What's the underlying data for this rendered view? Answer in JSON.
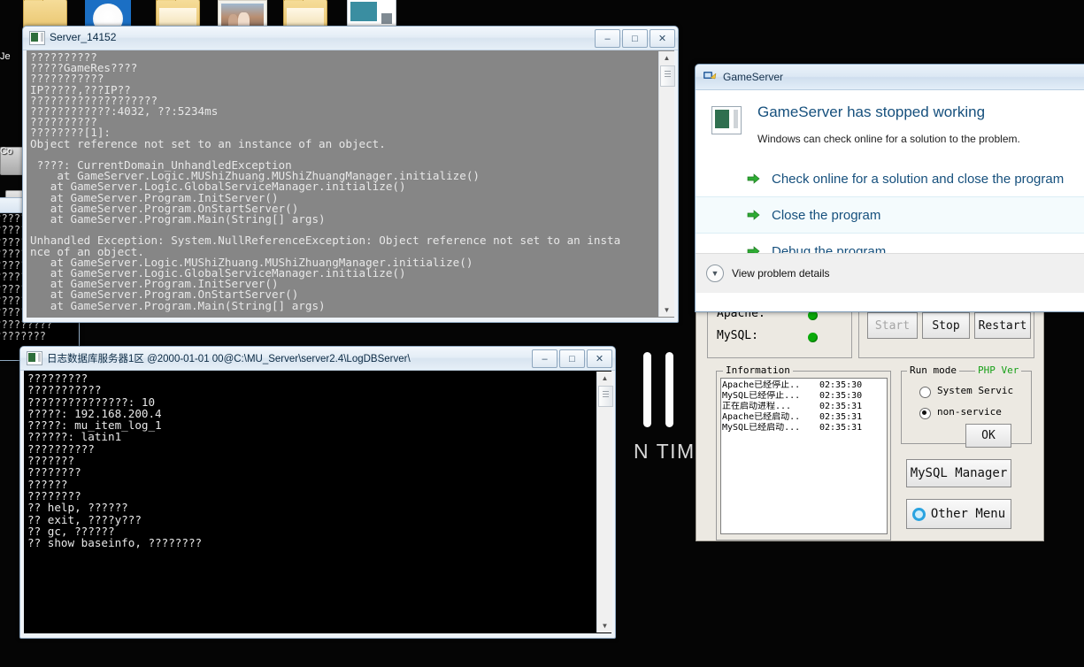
{
  "desktop": {
    "icons": [
      {
        "type": "folder-icon",
        "label": "Je"
      },
      {
        "type": "disc-icon",
        "label": ""
      },
      {
        "type": "folder-icon",
        "label": ""
      },
      {
        "type": "photo-icon",
        "label": ""
      },
      {
        "type": "folder-icon",
        "label": ""
      },
      {
        "type": "window-icon",
        "label": ""
      }
    ],
    "side_labels": [
      "Je",
      "Co"
    ],
    "wallpaper_text": "N TIME"
  },
  "server_window": {
    "title": "Server_14152",
    "buttons": {
      "minimize": "–",
      "maximize": "□",
      "close": "✕"
    },
    "console_lines": [
      "??????????",
      "?????GameRes????",
      "???????????",
      "IP?????,???IP??",
      "???????????????????",
      "????????????:4032, ??:5234ms",
      "??????????",
      "????????[1]:",
      "Object reference not set to an instance of an object.",
      "",
      " ????: CurrentDomain_UnhandledException",
      "    at GameServer.Logic.MUShiZhuang.MUShiZhuangManager.initialize()",
      "   at GameServer.Logic.GlobalServiceManager.initialize()",
      "   at GameServer.Program.InitServer()",
      "   at GameServer.Program.OnStartServer()",
      "   at GameServer.Program.Main(String[] args)",
      "",
      "Unhandled Exception: System.NullReferenceException: Object reference not set to an insta",
      "nce of an object.",
      "   at GameServer.Logic.MUShiZhuang.MUShiZhuangManager.initialize()",
      "   at GameServer.Logic.GlobalServiceManager.initialize()",
      "   at GameServer.Program.InitServer()",
      "   at GameServer.Program.OnStartServer()",
      "   at GameServer.Program.Main(String[] args)"
    ]
  },
  "logdb_window": {
    "title": "日志数据库服务器1区 @2000-01-01 00@C:\\MU_Server\\server2.4\\LogDBServer\\",
    "buttons": {
      "minimize": "–",
      "maximize": "□",
      "close": "✕"
    },
    "console_lines": [
      "?????????",
      "???????????",
      "???????????????: 10",
      "?????: 192.168.200.4",
      "?????: mu_item_log_1",
      "??????: latin1",
      "??????????",
      "???????",
      "????????",
      "??????",
      "????????",
      "?? help, ??????",
      "?? exit, ????y???",
      "?? gc, ??????",
      "?? show baseinfo, ????????"
    ]
  },
  "error_dialog": {
    "title": "GameServer",
    "heading": "GameServer has stopped working",
    "subtext": "Windows can check online for a solution to the problem.",
    "options": [
      {
        "label": "Check online for a solution and close the program",
        "highlighted": false
      },
      {
        "label": "Close the program",
        "highlighted": true
      },
      {
        "label": "Debug the program",
        "highlighted": false
      }
    ],
    "footer_label": "View problem details",
    "accent_color": "#16507d",
    "arrow_color": "#2eab33"
  },
  "xampp": {
    "services": [
      {
        "name": "Apache:",
        "status_color": "#0aaa0a"
      },
      {
        "name": "MySQL:",
        "status_color": "#0aaa0a"
      }
    ],
    "action_buttons": [
      {
        "label": "Start",
        "disabled": true
      },
      {
        "label": "Stop",
        "disabled": false
      },
      {
        "label": "Restart",
        "disabled": false
      }
    ],
    "information_legend": "Information",
    "information_rows": [
      {
        "text": "Apache已经停止..",
        "time": "02:35:30"
      },
      {
        "text": "MySQL已经停止...",
        "time": "02:35:30"
      },
      {
        "text": "正在启动进程...",
        "time": "02:35:31"
      },
      {
        "text": "Apache已经启动..",
        "time": "02:35:31"
      },
      {
        "text": "MySQL已经启动...",
        "time": "02:35:31"
      }
    ],
    "runmode_legend": "Run mode",
    "phpver_legend": "PHP Ver",
    "radios": [
      {
        "label": "System Servic",
        "selected": false
      },
      {
        "label": "non-service",
        "selected": true
      }
    ],
    "ok_label": "OK",
    "mysql_manager_label": "MySQL Manager",
    "other_menu_label": "Other Menu"
  }
}
